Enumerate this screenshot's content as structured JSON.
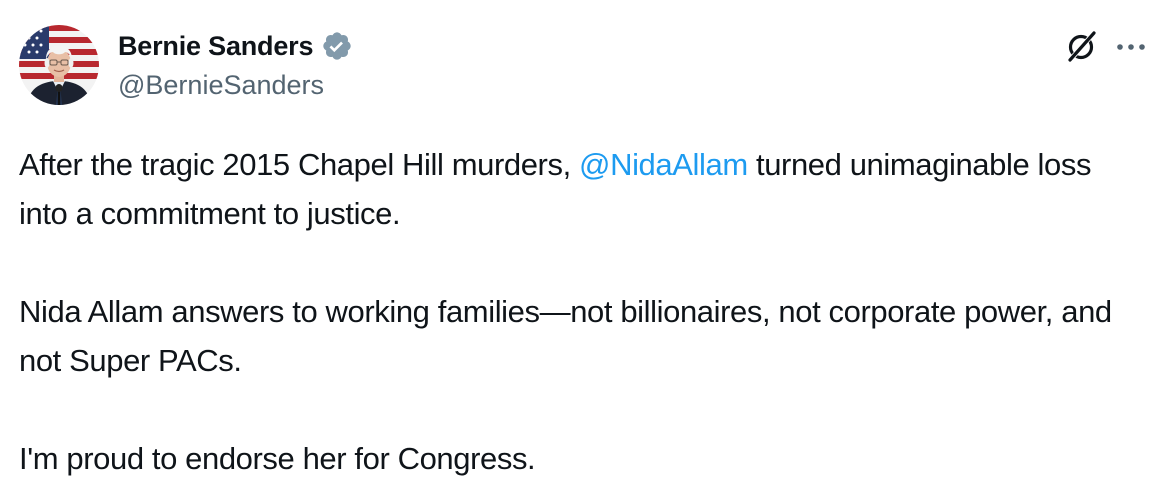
{
  "author": {
    "display_name": "Bernie Sanders",
    "handle": "@BernieSanders",
    "verified": true,
    "verified_badge_color": "#829aab"
  },
  "header_icons": {
    "grok": "grok-icon",
    "more": "more-options-icon"
  },
  "tweet": {
    "p1_before": "After the tragic 2015 Chapel Hill murders, ",
    "mention": "@NidaAllam",
    "p1_after": " turned unimaginable loss into a commitment to justice.",
    "p2": "Nida Allam answers to working families—not billionaires, not corporate power, and not Super PACs.",
    "p3": "I'm proud to endorse her for Congress."
  },
  "colors": {
    "text": "#0f1419",
    "secondary_text": "#536471",
    "link": "#1d9bf0"
  }
}
